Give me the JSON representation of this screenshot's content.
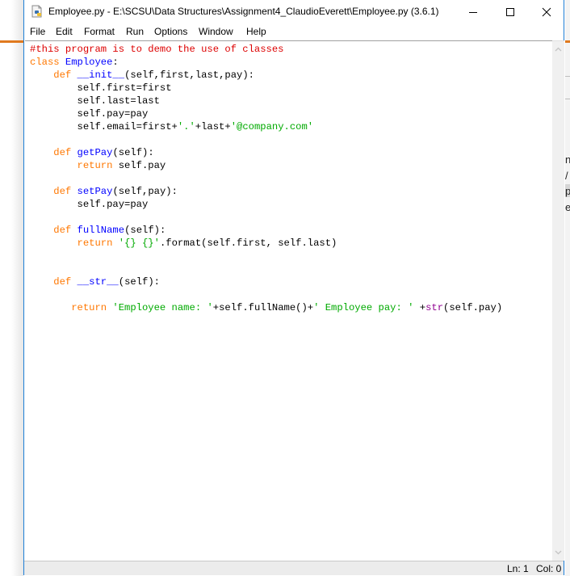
{
  "window": {
    "title": "Employee.py - E:\\SCSU\\Data Structures\\Assignment4_ClaudioEverett\\Employee.py (3.6.1)",
    "icon": "python-file-icon",
    "controls": {
      "minimize": "—",
      "maximize": "☐",
      "close": "✕"
    }
  },
  "menubar": {
    "items": [
      {
        "label": "File"
      },
      {
        "label": "Edit"
      },
      {
        "label": "Format"
      },
      {
        "label": "Run"
      },
      {
        "label": "Options"
      },
      {
        "label": "Window"
      },
      {
        "label": "Help"
      }
    ]
  },
  "editor": {
    "colors": {
      "comment": "#dd0000",
      "keyword": "#ff7700",
      "definition": "#0000ff",
      "string": "#00aa00",
      "builtin": "#900090"
    },
    "lines": [
      [
        {
          "t": "#this program is to demo the use of classes",
          "c": "comment"
        }
      ],
      [
        {
          "t": "class",
          "c": "kw"
        },
        {
          "t": " "
        },
        {
          "t": "Employee",
          "c": "def"
        },
        {
          "t": ":"
        }
      ],
      [
        {
          "t": "    "
        },
        {
          "t": "def",
          "c": "kw"
        },
        {
          "t": " "
        },
        {
          "t": "__init__",
          "c": "def"
        },
        {
          "t": "(self,first,last,pay):"
        }
      ],
      [
        {
          "t": "        self.first=first"
        }
      ],
      [
        {
          "t": "        self.last=last"
        }
      ],
      [
        {
          "t": "        self.pay=pay"
        }
      ],
      [
        {
          "t": "        self.email=first+"
        },
        {
          "t": "'.'",
          "c": "str"
        },
        {
          "t": "+last+"
        },
        {
          "t": "'@company.com'",
          "c": "str"
        }
      ],
      [
        {
          "t": ""
        }
      ],
      [
        {
          "t": "    "
        },
        {
          "t": "def",
          "c": "kw"
        },
        {
          "t": " "
        },
        {
          "t": "getPay",
          "c": "def"
        },
        {
          "t": "(self):"
        }
      ],
      [
        {
          "t": "        "
        },
        {
          "t": "return",
          "c": "kw"
        },
        {
          "t": " self.pay"
        }
      ],
      [
        {
          "t": ""
        }
      ],
      [
        {
          "t": "    "
        },
        {
          "t": "def",
          "c": "kw"
        },
        {
          "t": " "
        },
        {
          "t": "setPay",
          "c": "def"
        },
        {
          "t": "(self,pay):"
        }
      ],
      [
        {
          "t": "        self.pay=pay"
        }
      ],
      [
        {
          "t": ""
        }
      ],
      [
        {
          "t": "    "
        },
        {
          "t": "def",
          "c": "kw"
        },
        {
          "t": " "
        },
        {
          "t": "fullName",
          "c": "def"
        },
        {
          "t": "(self):"
        }
      ],
      [
        {
          "t": "        "
        },
        {
          "t": "return",
          "c": "kw"
        },
        {
          "t": " "
        },
        {
          "t": "'{} {}'",
          "c": "str"
        },
        {
          "t": ".format(self.first, self.last)"
        }
      ],
      [
        {
          "t": ""
        }
      ],
      [
        {
          "t": ""
        }
      ],
      [
        {
          "t": "    "
        },
        {
          "t": "def",
          "c": "kw"
        },
        {
          "t": " "
        },
        {
          "t": "__str__",
          "c": "def"
        },
        {
          "t": "(self):"
        }
      ],
      [
        {
          "t": ""
        }
      ],
      [
        {
          "t": "       "
        },
        {
          "t": "return",
          "c": "kw"
        },
        {
          "t": " "
        },
        {
          "t": "'Employee name: '",
          "c": "str"
        },
        {
          "t": "+self.fullName()+"
        },
        {
          "t": "' Employee pay: '",
          "c": "str"
        },
        {
          "t": " +"
        },
        {
          "t": "str",
          "c": "bi"
        },
        {
          "t": "(self.pay)"
        }
      ]
    ]
  },
  "scrollbar": {
    "up": "⌃",
    "down": "⌄"
  },
  "statusbar": {
    "ln": "Ln: 1",
    "col": "Col: 0"
  },
  "background_window": {
    "fragments": [
      "n",
      "/",
      "py",
      "e"
    ]
  }
}
